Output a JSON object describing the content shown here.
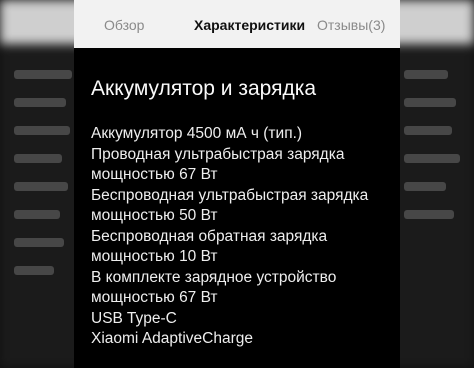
{
  "tabs": [
    {
      "label": "Обзор",
      "active": false
    },
    {
      "label": "Характеристики",
      "active": true
    },
    {
      "label": "Отзывы(3)",
      "active": false
    }
  ],
  "section": {
    "title": "Аккумулятор и зарядка",
    "lines": [
      "Аккумулятор 4500 мА ч (тип.)",
      "Проводная ультрабыстрая зарядка",
      "мощностью 67 Вт",
      "Беспроводная ультрабыстрая зарядка",
      "мощностью 50 Вт",
      "Беспроводная обратная зарядка",
      "мощностью 10 Вт",
      "В комплекте зарядное устройство",
      "мощностью 67 Вт",
      "USB Type-C",
      "Xiaomi AdaptiveCharge"
    ]
  },
  "colors": {
    "tab_bar_bg": "#f2f2f2",
    "card_bg": "#000000",
    "text": "#f0f0f0",
    "active_tab": "#111111",
    "inactive_tab": "#8a8a8a"
  }
}
